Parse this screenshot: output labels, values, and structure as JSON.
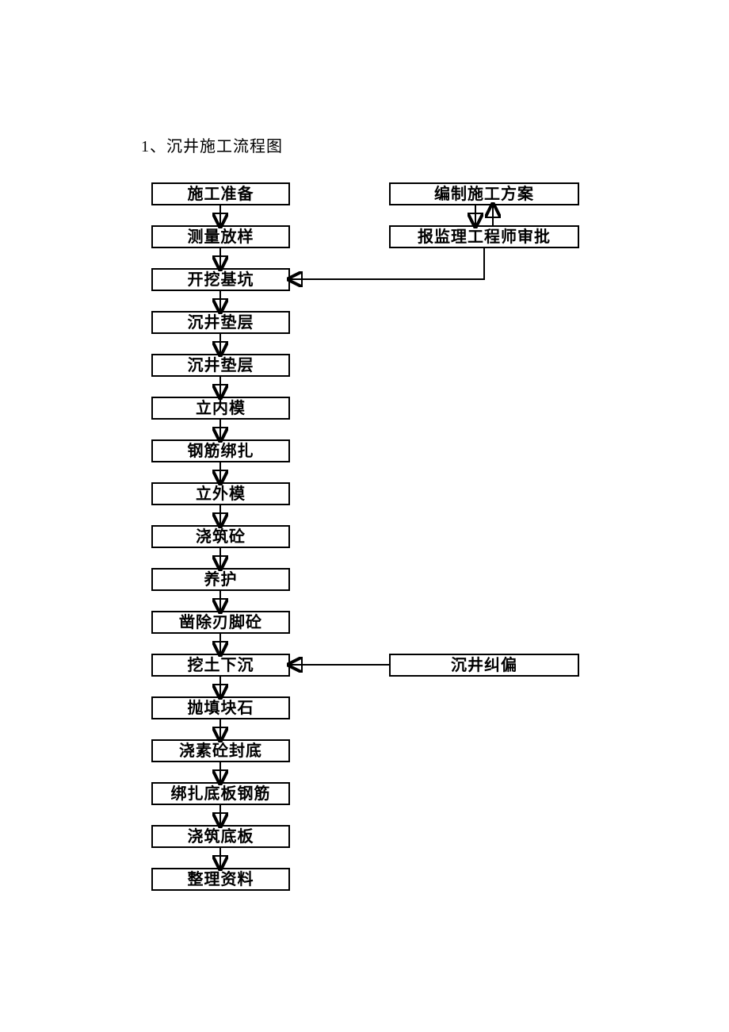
{
  "title": "1、沉井施工流程图",
  "nodes": {
    "n1": "施工准备",
    "n2": "测量放样",
    "n3": "开挖基坑",
    "n4": "沉井垫层",
    "n5": "沉井垫层",
    "n6": "立内模",
    "n7": "钢筋绑扎",
    "n8": "立外模",
    "n9": "浇筑砼",
    "n10": "养护",
    "n11": "凿除刃脚砼",
    "n12": "挖土下沉",
    "n13": "抛填块石",
    "n14": "浇素砼封底",
    "n15": "绑扎底板钢筋",
    "n16": "浇筑底板",
    "n17": "整理资料",
    "r1": "编制施工方案",
    "r2": "报监理工程师审批",
    "r3": "沉井纠偏"
  },
  "chart_data": {
    "type": "flowchart",
    "title": "沉井施工流程图",
    "nodes": [
      {
        "id": "n1",
        "label": "施工准备"
      },
      {
        "id": "n2",
        "label": "测量放样"
      },
      {
        "id": "n3",
        "label": "开挖基坑"
      },
      {
        "id": "n4",
        "label": "沉井垫层"
      },
      {
        "id": "n5",
        "label": "沉井垫层"
      },
      {
        "id": "n6",
        "label": "立内模"
      },
      {
        "id": "n7",
        "label": "钢筋绑扎"
      },
      {
        "id": "n8",
        "label": "立外模"
      },
      {
        "id": "n9",
        "label": "浇筑砼"
      },
      {
        "id": "n10",
        "label": "养护"
      },
      {
        "id": "n11",
        "label": "凿除刃脚砼"
      },
      {
        "id": "n12",
        "label": "挖土下沉"
      },
      {
        "id": "n13",
        "label": "抛填块石"
      },
      {
        "id": "n14",
        "label": "浇素砼封底"
      },
      {
        "id": "n15",
        "label": "绑扎底板钢筋"
      },
      {
        "id": "n16",
        "label": "浇筑底板"
      },
      {
        "id": "n17",
        "label": "整理资料"
      },
      {
        "id": "r1",
        "label": "编制施工方案"
      },
      {
        "id": "r2",
        "label": "报监理工程师审批"
      },
      {
        "id": "r3",
        "label": "沉井纠偏"
      }
    ],
    "edges": [
      {
        "from": "n1",
        "to": "n2"
      },
      {
        "from": "n2",
        "to": "n3"
      },
      {
        "from": "n3",
        "to": "n4"
      },
      {
        "from": "n4",
        "to": "n5"
      },
      {
        "from": "n5",
        "to": "n6"
      },
      {
        "from": "n6",
        "to": "n7"
      },
      {
        "from": "n7",
        "to": "n8"
      },
      {
        "from": "n8",
        "to": "n9"
      },
      {
        "from": "n9",
        "to": "n10"
      },
      {
        "from": "n10",
        "to": "n11"
      },
      {
        "from": "n11",
        "to": "n12"
      },
      {
        "from": "n12",
        "to": "n13"
      },
      {
        "from": "n13",
        "to": "n14"
      },
      {
        "from": "n14",
        "to": "n15"
      },
      {
        "from": "n15",
        "to": "n16"
      },
      {
        "from": "n16",
        "to": "n17"
      },
      {
        "from": "r1",
        "to": "r2"
      },
      {
        "from": "r2",
        "to": "r1"
      },
      {
        "from": "r2",
        "to": "n3"
      },
      {
        "from": "r3",
        "to": "n12"
      }
    ]
  }
}
